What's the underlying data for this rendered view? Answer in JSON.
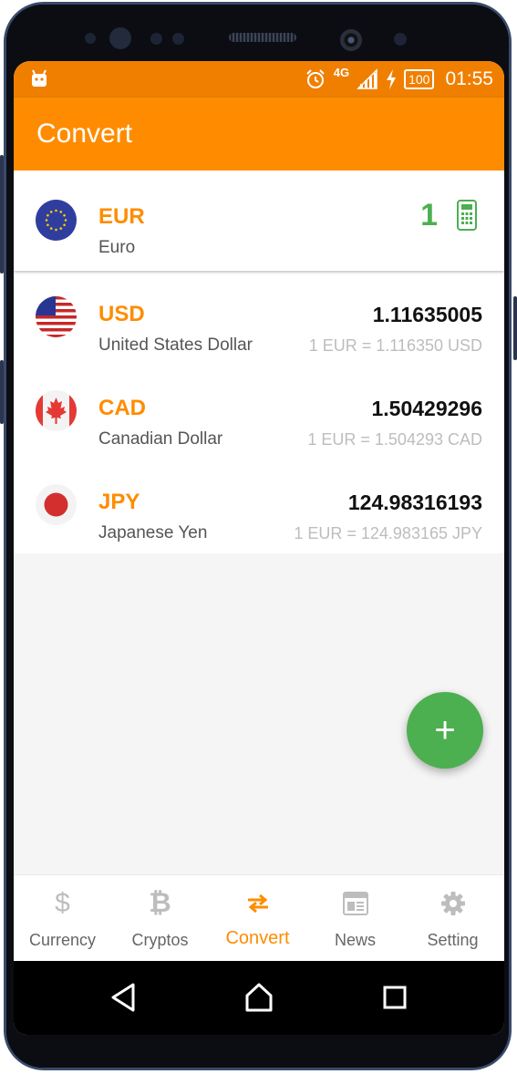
{
  "status_bar": {
    "network": "4G",
    "battery": "100",
    "time": "01:55"
  },
  "app_bar": {
    "title": "Convert"
  },
  "base_currency": {
    "code": "EUR",
    "name": "Euro",
    "amount": "1"
  },
  "currencies": [
    {
      "code": "USD",
      "name": "United States Dollar",
      "value": "1.11635005",
      "rate": "1 EUR = 1.116350 USD"
    },
    {
      "code": "CAD",
      "name": "Canadian Dollar",
      "value": "1.50429296",
      "rate": "1 EUR = 1.504293 CAD"
    },
    {
      "code": "JPY",
      "name": "Japanese Yen",
      "value": "124.98316193",
      "rate": "1 EUR = 124.983165 JPY"
    }
  ],
  "fab": {
    "icon": "plus-icon",
    "label": "+"
  },
  "bottom_nav": [
    {
      "label": "Currency",
      "icon": "dollar-icon",
      "active": false
    },
    {
      "label": "Cryptos",
      "icon": "bitcoin-icon",
      "active": false
    },
    {
      "label": "Convert",
      "icon": "swap-arrows-icon",
      "active": true
    },
    {
      "label": "News",
      "icon": "newspaper-icon",
      "active": false
    },
    {
      "label": "Setting",
      "icon": "gear-icon",
      "active": false
    }
  ],
  "colors": {
    "primary": "#ff8c00",
    "status_bar": "#f07f00",
    "accent_green": "#4caf50",
    "inactive": "#bdbdbd"
  }
}
